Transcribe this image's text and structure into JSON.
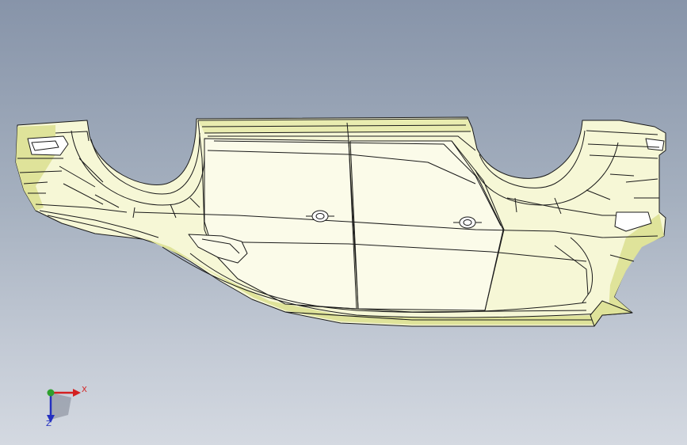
{
  "viewport": {
    "background_top": "#8794a9",
    "background_bottom": "#d4d9e1"
  },
  "model": {
    "fill_color": "#f7f8d8",
    "shade_color": "#dfe39a",
    "edge_color": "#1a1a1a",
    "icons": [
      "car-body-model-icon"
    ]
  },
  "triad": {
    "x_label": "X",
    "z_label": "Z",
    "x_color": "#d42020",
    "y_color": "#2ea02e",
    "z_color": "#2430c0"
  }
}
